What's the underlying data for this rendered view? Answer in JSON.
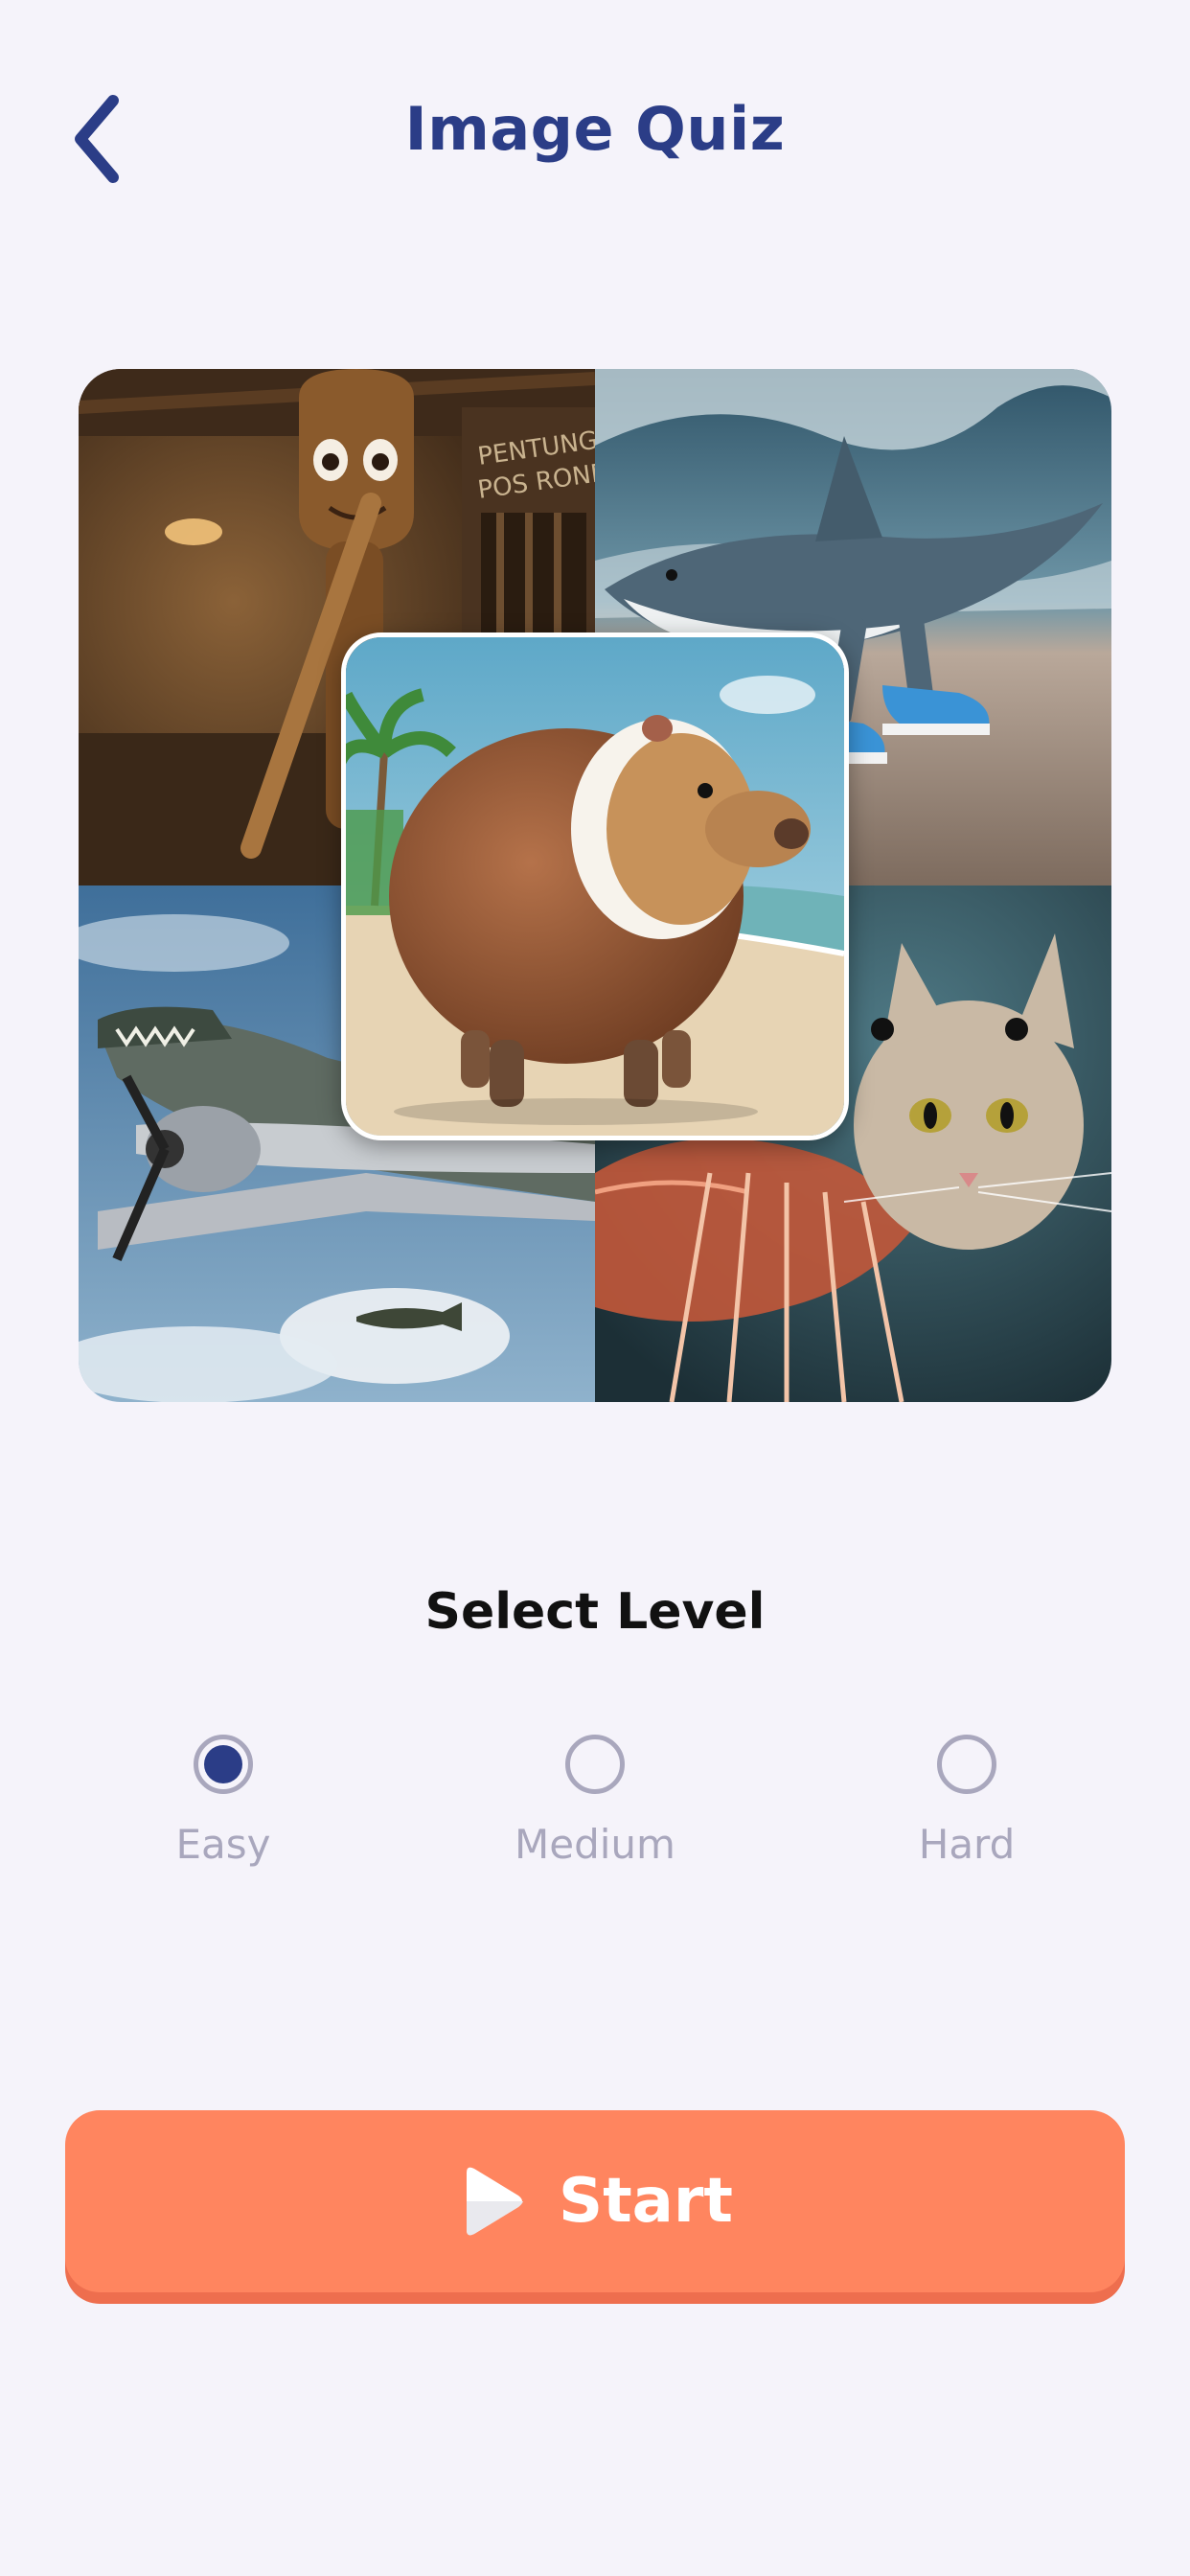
{
  "header": {
    "title": "Image Quiz",
    "back_icon": "chevron-left-icon"
  },
  "collage": {
    "tiles": [
      {
        "name": "wooden-figure-image",
        "sign_text": "PENTUNGAN POS RONDA"
      },
      {
        "name": "shark-sneakers-image"
      },
      {
        "name": "crocodile-plane-image"
      },
      {
        "name": "shrimp-cat-image"
      }
    ],
    "center": {
      "name": "coconut-capybara-image"
    }
  },
  "level_select": {
    "heading": "Select Level",
    "options": [
      {
        "label": "Easy",
        "selected": true
      },
      {
        "label": "Medium",
        "selected": false
      },
      {
        "label": "Hard",
        "selected": false
      }
    ]
  },
  "start_button": {
    "label": "Start",
    "icon": "play-icon"
  },
  "colors": {
    "background": "#f5f3fa",
    "title": "#2b3d87",
    "radio_selected": "#2b3d87",
    "radio_idle": "#a9a7bd",
    "start_button": "#ff855f"
  }
}
